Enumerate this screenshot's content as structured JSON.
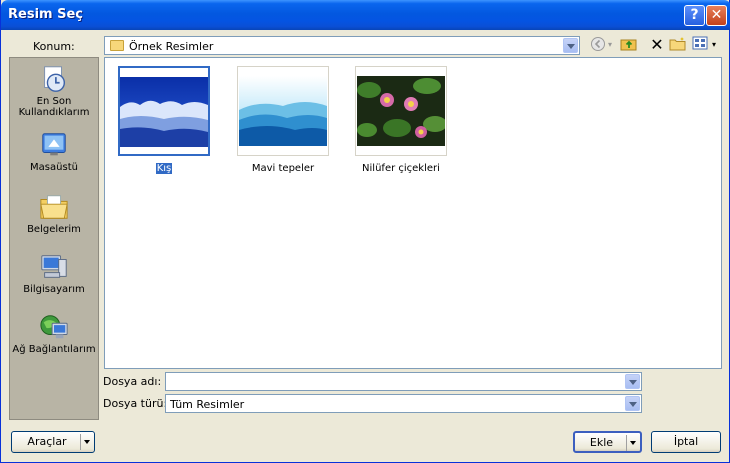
{
  "window": {
    "title": "Resim Seç",
    "help_label": "?",
    "close_label": "✕"
  },
  "location": {
    "label": "Konum:",
    "value": "Örnek Resimler"
  },
  "toolbar": {
    "icons": [
      "back-icon",
      "up-folder-icon",
      "delete-icon",
      "new-folder-icon",
      "views-icon"
    ]
  },
  "places": [
    {
      "label": "En Son Kullandıklarım",
      "icon": "recent-documents-icon"
    },
    {
      "label": "Masaüstü",
      "icon": "desktop-icon"
    },
    {
      "label": "Belgelerim",
      "icon": "my-documents-icon"
    },
    {
      "label": "Bilgisayarım",
      "icon": "my-computer-icon"
    },
    {
      "label": "Ağ Bağlantılarım",
      "icon": "network-icon"
    }
  ],
  "files": [
    {
      "name": "Kış",
      "selected": true
    },
    {
      "name": "Mavi tepeler",
      "selected": false
    },
    {
      "name": "Nilüfer çiçekleri",
      "selected": false
    }
  ],
  "filename": {
    "label": "Dosya adı:",
    "value": ""
  },
  "filetype": {
    "label": "Dosya türü:",
    "value": "Tüm Resimler"
  },
  "buttons": {
    "tools": "Araçlar",
    "insert": "Ekle",
    "cancel": "İptal"
  }
}
